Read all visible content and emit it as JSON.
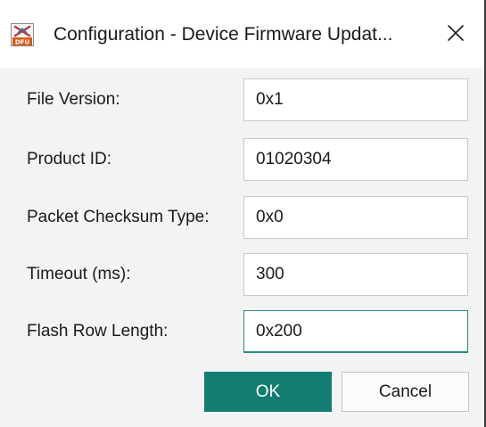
{
  "window": {
    "title": "Configuration - Device Firmware Updat...",
    "icon": "dfu-icon",
    "icon_text": "DFU",
    "close_icon": "close-icon"
  },
  "form": {
    "fields": [
      {
        "label": "File Version:",
        "value": "0x1"
      },
      {
        "label": "Product ID:",
        "value": "01020304"
      },
      {
        "label": "Packet Checksum Type:",
        "value": "0x0"
      },
      {
        "label": "Timeout (ms):",
        "value": "300"
      },
      {
        "label": "Flash Row Length:",
        "value": "0x200"
      }
    ]
  },
  "buttons": {
    "ok_label": "OK",
    "cancel_label": "Cancel"
  },
  "colors": {
    "accent": "#127d70",
    "focus_border": "#2a8a7c",
    "dialog_bg": "#f3f3f3"
  }
}
